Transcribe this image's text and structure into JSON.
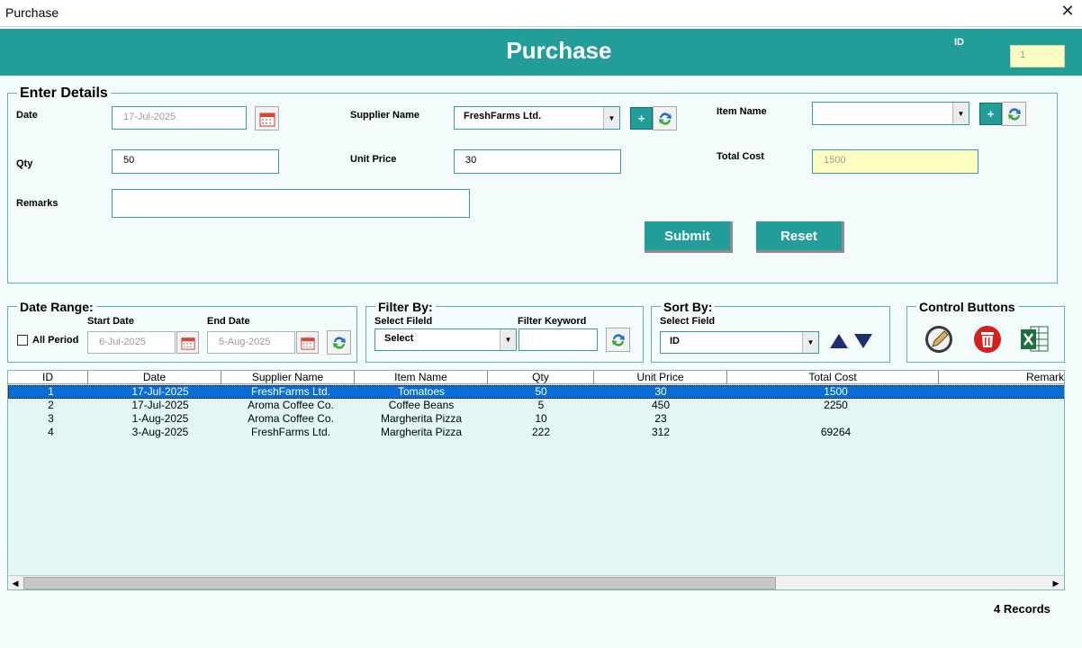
{
  "window": {
    "title": "Purchase",
    "close_glyph": "✕"
  },
  "header": {
    "title": "Purchase",
    "id_label": "ID",
    "id_value": "1"
  },
  "details": {
    "legend": "Enter Details",
    "date_label": "Date",
    "date_value": "17-Jul-2025",
    "supplier_label": "Supplier Name",
    "supplier_value": "FreshFarms Ltd.",
    "item_label": "Item Name",
    "item_value": "",
    "qty_label": "Qty",
    "qty_value": "50",
    "price_label": "Unit Price",
    "price_value": "30",
    "total_label": "Total Cost",
    "total_value": "1500",
    "remarks_label": "Remarks",
    "remarks_value": "",
    "submit_label": "Submit",
    "reset_label": "Reset",
    "plus_glyph": "+"
  },
  "date_range": {
    "legend": "Date Range:",
    "all_period_label": "All Period",
    "start_label": "Start Date",
    "start_value": "6-Jul-2025",
    "end_label": "End Date",
    "end_value": "5-Aug-2025"
  },
  "filter": {
    "legend": "Filter By:",
    "field_label": "Select Fileld",
    "field_value": "Select",
    "keyword_label": "Filter Keyword",
    "keyword_value": ""
  },
  "sort": {
    "legend": "Sort By:",
    "field_label": "Select Field",
    "field_value": "ID"
  },
  "controls": {
    "legend": "Control Buttons"
  },
  "table": {
    "columns": [
      "ID",
      "Date",
      "Supplier Name",
      "Item Name",
      "Qty",
      "Unit Price",
      "Total Cost",
      "Remark"
    ],
    "rows": [
      [
        "1",
        "17-Jul-2025",
        "FreshFarms Ltd.",
        "Tomatoes",
        "50",
        "30",
        "1500",
        ""
      ],
      [
        "2",
        "17-Jul-2025",
        "Aroma Coffee Co.",
        "Coffee Beans",
        "5",
        "450",
        "2250",
        ""
      ],
      [
        "3",
        "1-Aug-2025",
        "Aroma Coffee Co.",
        "Margherita Pizza",
        "10",
        "23",
        "",
        ""
      ],
      [
        "4",
        "3-Aug-2025",
        "FreshFarms Ltd.",
        "Margherita Pizza",
        "222",
        "312",
        "69264",
        ""
      ]
    ],
    "selected_row": 0
  },
  "status": {
    "records": "4 Records"
  },
  "colors": {
    "accent": "#239d9a",
    "selection": "#0a6dd6",
    "readonly_yellow": "#ffffc4"
  }
}
